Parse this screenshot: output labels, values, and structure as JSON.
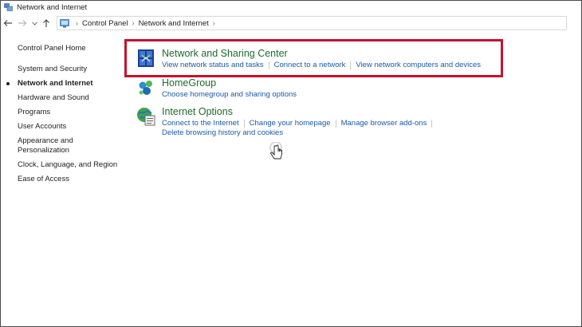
{
  "window": {
    "title": "Network and Internet"
  },
  "address_bar": {
    "breadcrumbs": [
      "Control Panel",
      "Network and Internet"
    ]
  },
  "left_nav": {
    "home": "Control Panel Home",
    "items": [
      {
        "label": "System and Security",
        "current": false
      },
      {
        "label": "Network and Internet",
        "current": true
      },
      {
        "label": "Hardware and Sound",
        "current": false
      },
      {
        "label": "Programs",
        "current": false
      },
      {
        "label": "User Accounts",
        "current": false
      },
      {
        "label": "Appearance and Personalization",
        "current": false
      },
      {
        "label": "Clock, Language, and Region",
        "current": false
      },
      {
        "label": "Ease of Access",
        "current": false
      }
    ]
  },
  "categories": [
    {
      "title": "Network and Sharing Center",
      "icon": "network-sharing-icon",
      "links": [
        "View network status and tasks",
        "Connect to a network",
        "View network computers and devices"
      ]
    },
    {
      "title": "HomeGroup",
      "icon": "homegroup-icon",
      "links": [
        "Choose homegroup and sharing options"
      ]
    },
    {
      "title": "Internet Options",
      "icon": "internet-options-icon",
      "links": [
        "Connect to the Internet",
        "Change your homepage",
        "Manage browser add-ons"
      ],
      "links_row2": [
        "Delete browsing history and cookies"
      ]
    }
  ],
  "colors": {
    "highlight": "#c8102e",
    "category_title": "#1e6b2e",
    "link": "#1a5aa6"
  }
}
